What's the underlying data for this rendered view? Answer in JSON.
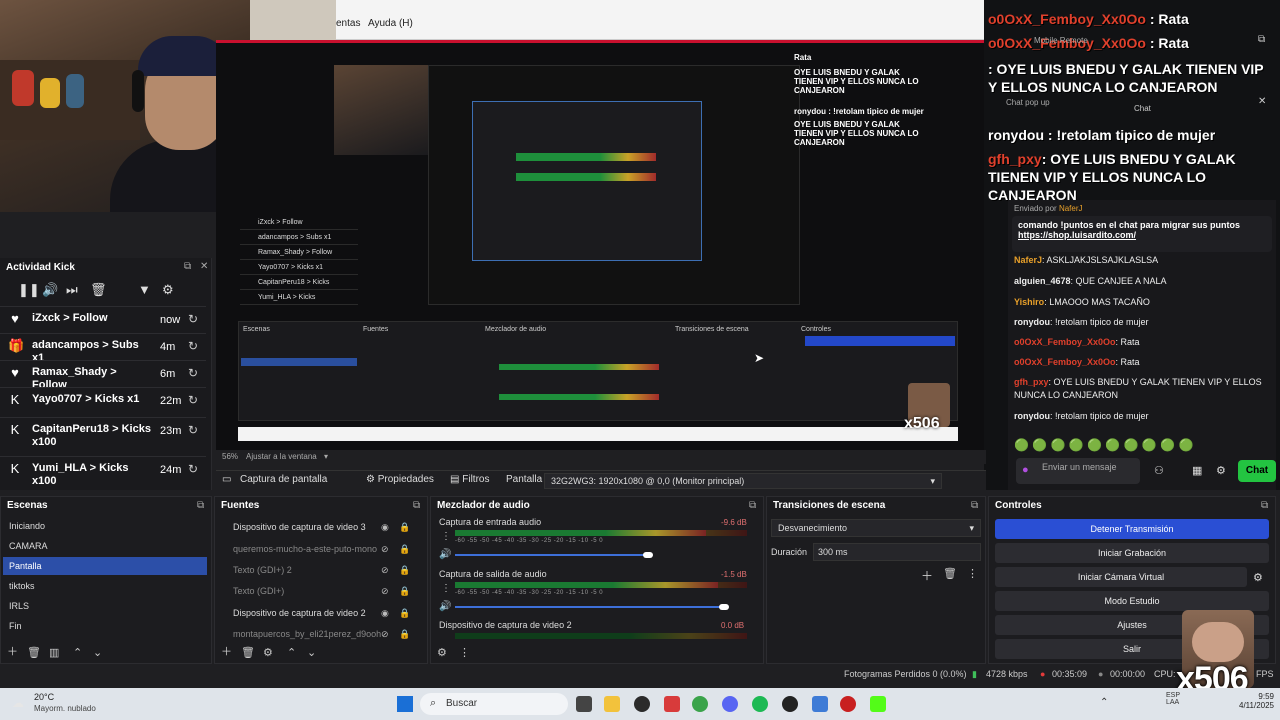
{
  "menu": {
    "item1": "entas",
    "item2": "Ayuda (H)"
  },
  "chat_overlay": {
    "lines": [
      {
        "user": "o0OxX_Femboy_Xx0Oo",
        "sep": " : ",
        "msg": "Rata"
      },
      {
        "user": "o0OxX_Femboy_Xx0Oo",
        "sep": " : ",
        "msg": "Rata"
      },
      {
        "user": "",
        "sep": "",
        "msg": ": OYE LUIS BNEDU Y GALAK TIENEN VIP Y ELLOS NUNCA LO CANJEARON"
      },
      {
        "user": "ronydou",
        "sep": " : ",
        "msg": "!retolam tipico de mujer"
      },
      {
        "user": "gfh_pxy",
        "sep": "",
        "msg": ": OYE LUIS BNEDU Y GALAK TIENEN VIP Y ELLOS NUNCA LO CANJEARON"
      }
    ],
    "small_chat": "Chat",
    "small_popup": "Chat pop up",
    "small_rep": "Mobile Remote"
  },
  "chat_panel": {
    "pinned_by": "Enviado por",
    "pinned_user": "NaferJ",
    "pinned_text": "comando !puntos en el chat para migrar sus puntos",
    "pinned_link": "https://shop.luisardito.com/",
    "messages": [
      {
        "user": "NaferJ",
        "text": ": ASKLJAKJSLSAJKLASLSA",
        "color": "#e8a02a"
      },
      {
        "user": "alguien_4678",
        "text": ": QUE CANJEE A NALA",
        "color": "#ffffff"
      },
      {
        "user": "Yishiro",
        "text": ": LMAOOO MAS TACAÑO",
        "color": "#ffffff"
      },
      {
        "user": "ronydou",
        "text": ": !retolam tipico de mujer",
        "color": "#ffffff"
      },
      {
        "user": "o0OxX_Femboy_Xx0Oo",
        "text": ": Rata",
        "color": "#e0402c"
      },
      {
        "user": "o0OxX_Femboy_Xx0Oo",
        "text": ": Rata",
        "color": "#e0402c"
      },
      {
        "user": "gfh_pxy",
        "text": ": OYE LUIS BNEDU Y GALAK TIENEN VIP Y ELLOS NUNCA LO CANJEARON",
        "color": "#e0402c"
      },
      {
        "user": "ronydou",
        "text": ": !retolam tipico de mujer",
        "color": "#ffffff"
      }
    ],
    "input_placeholder": "Enviar un mensaje",
    "chat_button": "Chat"
  },
  "kick": {
    "title": "Actividad Kick",
    "rows": [
      {
        "icon": "♥",
        "user": "iZxck",
        "action": "Follow",
        "time": "now"
      },
      {
        "icon": "🎁",
        "user": "adancampos",
        "action": "Subs x1",
        "time": "4m"
      },
      {
        "icon": "♥",
        "user": "Ramax_Shady",
        "action": "Follow",
        "time": "6m"
      },
      {
        "icon": "K",
        "user": "Yayo0707",
        "action": "Kicks x1",
        "time": "22m"
      },
      {
        "icon": "K",
        "user": "CapitanPeru18",
        "action": "Kicks x100",
        "time": "23m"
      },
      {
        "icon": "K",
        "user": "Yumi_HLA",
        "action": "Kicks x100",
        "time": "24m"
      }
    ],
    "arrow": " > "
  },
  "preview": {
    "zoom": "56%",
    "fit": "Ajustar a la ventana"
  },
  "source_bar": {
    "source": "Captura de pantalla",
    "props": "Propiedades",
    "filters": "Filtros",
    "display_label": "Pantalla",
    "display_value": "32G2WG3: 1920x1080 @ 0,0 (Monitor principal)"
  },
  "scenes": {
    "title": "Escenas",
    "items": [
      "Iniciando",
      "CAMARA",
      "Pantalla",
      "tiktoks",
      "IRLS",
      "Fin"
    ],
    "selected": 2
  },
  "sources": {
    "title": "Fuentes",
    "items": [
      {
        "name": "Dispositivo de captura de video 3",
        "dim": false
      },
      {
        "name": "queremos-mucho-a-este-puto-mono",
        "dim": true
      },
      {
        "name": "Texto (GDI+) 2",
        "dim": true
      },
      {
        "name": "Texto (GDI+)",
        "dim": true
      },
      {
        "name": "Dispositivo de captura de video 2",
        "dim": false
      },
      {
        "name": "montapuercos_by_eli21perez_d9ooh",
        "dim": true
      }
    ]
  },
  "mixer": {
    "title": "Mezclador de audio",
    "scale": "-60  -55  -50  -45  -40  -35  -30  -25  -20  -15  -10  -5  0",
    "channels": [
      {
        "name": "Captura de entrada audio",
        "db": "-9.6 dB",
        "level": 0.86,
        "vol": 0.66
      },
      {
        "name": "Captura de salida de audio",
        "db": "-1.5 dB",
        "level": 0.9,
        "vol": 0.92
      },
      {
        "name": "Dispositivo de captura de video 2",
        "db": "0.0 dB",
        "level": 0.0,
        "vol": 0.0
      }
    ]
  },
  "transitions": {
    "title": "Transiciones de escena",
    "selected": "Desvanecimiento",
    "duration_label": "Duración",
    "duration_value": "300 ms"
  },
  "controls": {
    "title": "Controles",
    "buttons": [
      "Detener Transmisión",
      "Iniciar Grabación",
      "Iniciar Cámara Virtual",
      "Modo Estudio",
      "Ajustes",
      "Salir"
    ]
  },
  "status": {
    "dropped": "Fotogramas Perdidos 0 (0.0%)",
    "bitrate": "4728 kbps",
    "live_time": "00:35:09",
    "rec_time": "00:00:00",
    "cpu": "CPU:",
    "fps": "FPS"
  },
  "taskbar": {
    "temp": "20°C",
    "weather": "Mayorm. nublado",
    "search": "Buscar",
    "lang1": "ESP",
    "lang2": "LAA",
    "time": "9:59",
    "date": "4/11/2025"
  },
  "emote_text": "x506",
  "nested": {
    "chat_lines": [
      "Rata",
      "OYE LUIS BNEDU Y GALAK",
      "TIENEN VIP Y ELLOS NUNCA LO CANJEARON",
      "ronydou : !retolam tipico de mujer",
      "OYE LUIS BNEDU Y GALAK",
      "TIENEN VIP Y ELLOS NUNCA LO CANJEARON"
    ],
    "feed": [
      "iZxck > Follow",
      "adancampos > Subs x1",
      "Ramax_Shady > Follow",
      "Yayo0707 > Kicks x1",
      "CapitanPeru18 > Kicks",
      "Yumi_HLA > Kicks"
    ]
  }
}
